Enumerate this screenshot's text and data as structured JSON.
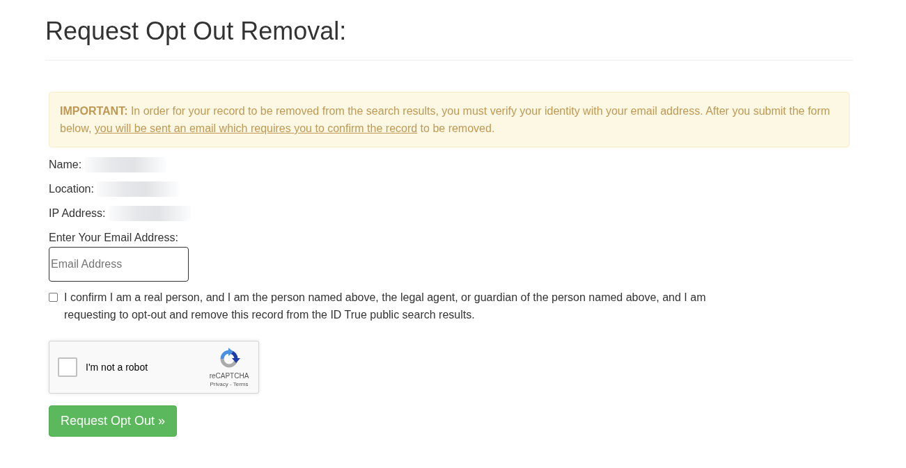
{
  "heading": "Request Opt Out Removal:",
  "notice": {
    "text": "**IMPORTANT:** In order for your record to be removed from the search results, you must verify your identity with your email address. After you submit the form below,",
    "link": "you will be sent an email which requires you to confirm the record",
    "text_after": "to be removed."
  },
  "details": [
    {
      "label": "Name:",
      "redacted": true
    },
    {
      "label": "Location:",
      "redacted": true
    },
    {
      "label": "IP Address:",
      "redacted": true
    }
  ],
  "email": {
    "label": "Enter Your Email Address:",
    "placeholder": "Email Address"
  },
  "consent": {
    "checked": false,
    "text": "I confirm I am a real person, and I am the person named above, the legal agent, or guardian of the person named above, and I am requesting to opt-out and remove this record from the ID True public search results."
  },
  "captcha": {
    "checked": false,
    "label": "I'm not a robot",
    "brand": "reCAPTCHA",
    "footer": "Privacy - Terms"
  },
  "submit": "Request Opt Out »"
}
